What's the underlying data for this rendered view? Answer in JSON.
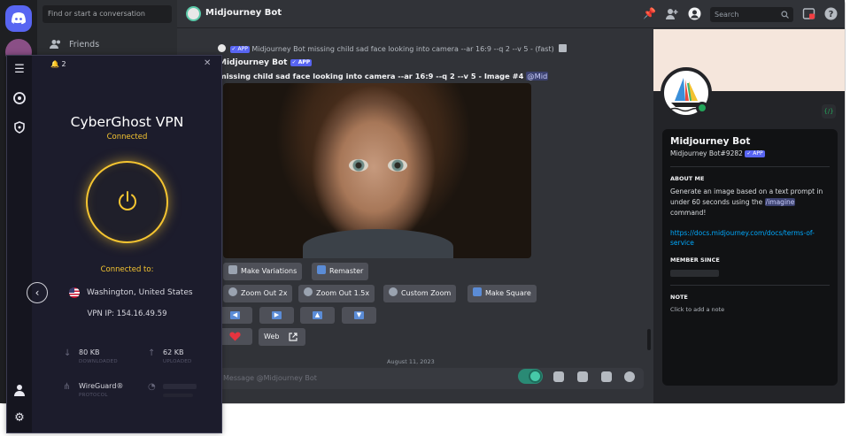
{
  "discord": {
    "find_placeholder": "Find or start a conversation",
    "friends_label": "Friends",
    "channel_title": "Midjourney Bot",
    "search_placeholder": "Search",
    "message_reply": "Midjourney Bot missing child sad face looking into camera --ar 16:9 --q 2 --v 5 - (fast)",
    "app_badge": "✓ APP",
    "author": "Midjourney Bot",
    "message_text": "missing child sad face looking into camera --ar 16:9 --q 2 --v 5 - Image #4",
    "mention": "@Mid",
    "buttons": {
      "make_variations": "Make Variations",
      "remaster": "Remaster",
      "zoom_out_2x": "Zoom Out 2x",
      "zoom_out_15x": "Zoom Out 1.5x",
      "custom_zoom": "Custom Zoom",
      "make_square": "Make Square",
      "web": "Web"
    },
    "date_separator": "August 11, 2023",
    "message_placeholder": "Message @Midjourney Bot",
    "profile": {
      "name": "Midjourney Bot",
      "tag": "Midjourney Bot#9282",
      "about_header": "ABOUT ME",
      "about_text_1": "Generate an image based on a text prompt in",
      "about_text_2": "under 60 seconds using the",
      "imagine_cmd": "/imagine",
      "about_text_3": "command!",
      "docs_link_1": "https://docs.midjourney.com/docs/terms-of-",
      "docs_link_2": "service",
      "member_since_header": "MEMBER SINCE",
      "note_header": "NOTE",
      "note_placeholder": "Click to add a note",
      "slash_label": "{/}"
    }
  },
  "cyberghost": {
    "notification_count": "2",
    "title": "CyberGhost VPN",
    "status": "Connected",
    "connected_to_label": "Connected to:",
    "location": "Washington, United States",
    "vpn_ip": "VPN IP: 154.16.49.59",
    "download_value": "80 KB",
    "download_label": "DOWNLOADED",
    "upload_value": "62 KB",
    "upload_label": "UPLOADED",
    "protocol_value": "WireGuard®",
    "protocol_label": "PROTOCOL"
  },
  "colors": {
    "accent_yellow": "#f5c531",
    "discord_blurple": "#5865f2",
    "online_green": "#23a55a"
  }
}
